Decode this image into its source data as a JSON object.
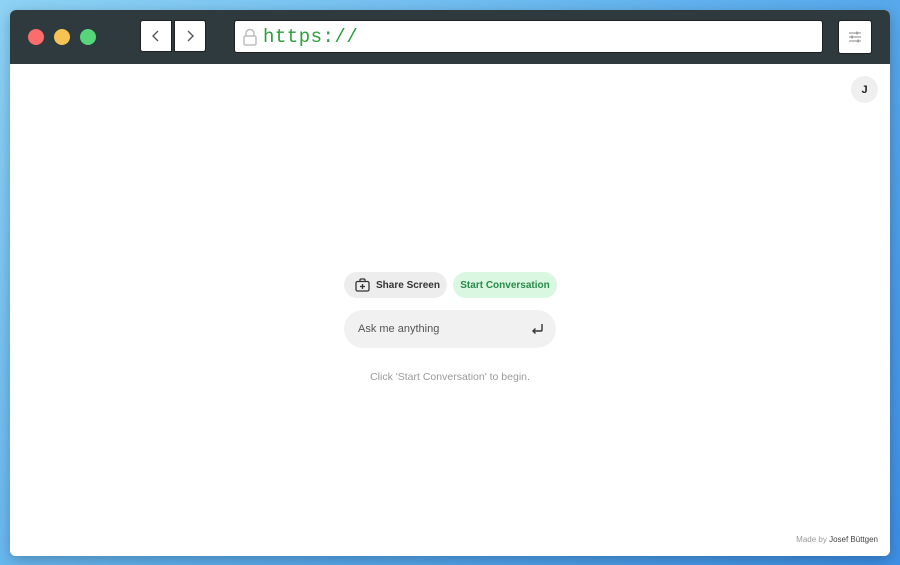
{
  "browser": {
    "url": "https://",
    "url_color": "#2e9e3e",
    "traffic_colors": {
      "close": "#fe6b6b",
      "minimize": "#f6c453",
      "maximize": "#57d57a"
    },
    "icons": {
      "back": "chevron-left-icon",
      "forward": "chevron-right-icon",
      "lock": "lock-icon",
      "settings": "sliders-icon"
    }
  },
  "page": {
    "avatar_initial": "J",
    "share_button_label": "Share Screen",
    "start_button_label": "Start Conversation",
    "ask_placeholder": "Ask me anything",
    "hint": "Click 'Start Conversation' to begin.",
    "footer_prefix": "Made by",
    "footer_author": "Josef Büttgen",
    "accent_color": "#2a8a47",
    "accent_bg": "#d9f7e1"
  }
}
